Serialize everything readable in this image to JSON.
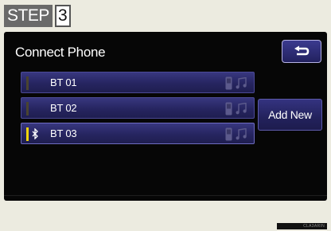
{
  "step": {
    "word": "STEP",
    "number": "3"
  },
  "screen": {
    "title": "Connect Phone",
    "back_icon": "return-arrow-icon",
    "devices": [
      {
        "label": "BT 01",
        "connected": false,
        "icons": [
          "phone-icon",
          "music-icon"
        ]
      },
      {
        "label": "BT 02",
        "connected": false,
        "icons": [
          "phone-icon",
          "music-icon"
        ]
      },
      {
        "label": "BT 03",
        "connected": true,
        "icons": [
          "bluetooth-icon",
          "phone-icon",
          "music-icon"
        ]
      }
    ],
    "add_new_label": "Add New"
  },
  "image_code": "CLA3ARIN",
  "colors": {
    "button_blue": "#262560",
    "active_indicator": "#f2d40c",
    "screen_bg": "#060606",
    "page_bg": "#ecebe0"
  }
}
